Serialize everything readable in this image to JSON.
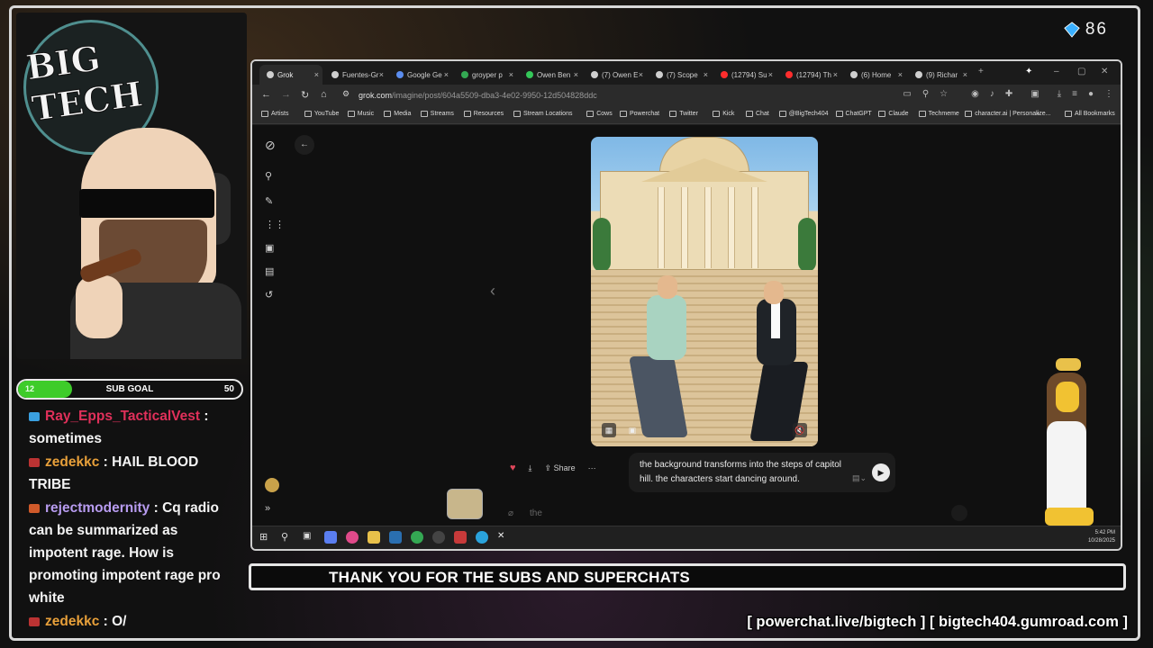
{
  "overlay": {
    "viewer_count": "86",
    "logo": [
      "BIG",
      "TECH"
    ],
    "sub_goal": {
      "label": "SUB GOAL",
      "current": "12",
      "max": "50",
      "progress": 0.24
    },
    "banner": "THANK YOU FOR THE SUBS AND SUPERCHATS",
    "links": "[ powerchat.live/bigtech ] [ bigtech404.gumroad.com ]",
    "accent_color": "#3ecc2a"
  },
  "chat": [
    {
      "user": "Ray_Epps_TacticalVest",
      "user_color": "#e0305a",
      "badge_color": "#3aa0e0",
      "text": ": sometimes"
    },
    {
      "user": "zedekkc",
      "user_color": "#e8a03a",
      "badge_color": "#b33",
      "text": ": HAIL BLOOD TRIBE"
    },
    {
      "user": "rejectmodernity",
      "user_color": "#b89cf0",
      "badge_color": "#d05a2a",
      "text": ": Cq radio can be summarized as impotent rage. How is promoting impotent rage pro white"
    },
    {
      "user": "zedekkc",
      "user_color": "#e8a03a",
      "badge_color": "#b33",
      "text": ": O/"
    }
  ],
  "browser": {
    "tabs": [
      {
        "label": "Grok",
        "color": "#cfcfcf",
        "active": true
      },
      {
        "label": "Fuentes-Gr",
        "color": "#cfcfcf"
      },
      {
        "label": "Google Ge",
        "color": "#5b8def"
      },
      {
        "label": "groyper p",
        "color": "#34a853"
      },
      {
        "label": "Owen Ben",
        "color": "#34c759"
      },
      {
        "label": "(7) Owen E",
        "color": "#cfcfcf"
      },
      {
        "label": "(7) Scope",
        "color": "#cfcfcf"
      },
      {
        "label": "(12794) Su",
        "color": "#ff2d2d"
      },
      {
        "label": "(12794) Th",
        "color": "#ff2d2d"
      },
      {
        "label": "(6) Home",
        "color": "#cfcfcf"
      },
      {
        "label": "(9) Richar",
        "color": "#cfcfcf"
      }
    ],
    "new_tab": "+",
    "url_host": "grok.com",
    "url_path": "/imagine/post/604a5509-dba3-4e02-9950-12d504828ddc",
    "bookmarks": [
      "Artists",
      "YouTube",
      "Music",
      "Media",
      "Streams",
      "Resources",
      "Stream Locations",
      "Cows",
      "Powerchat",
      "Twitter",
      "Kick",
      "Chat",
      "@BigTech404",
      "ChatGPT",
      "Claude",
      "Techmeme",
      "character.ai | Personalize..."
    ],
    "bookmarks_more": "»",
    "all_bookmarks": "All Bookmarks",
    "share_label": "Share",
    "more_label": "···",
    "prompt_text": "the background transforms into the steps of capitol hill. the characters start dancing around.",
    "input_placeholder": "the",
    "clock_time": "5:42 PM",
    "clock_date": "10/28/2025"
  }
}
